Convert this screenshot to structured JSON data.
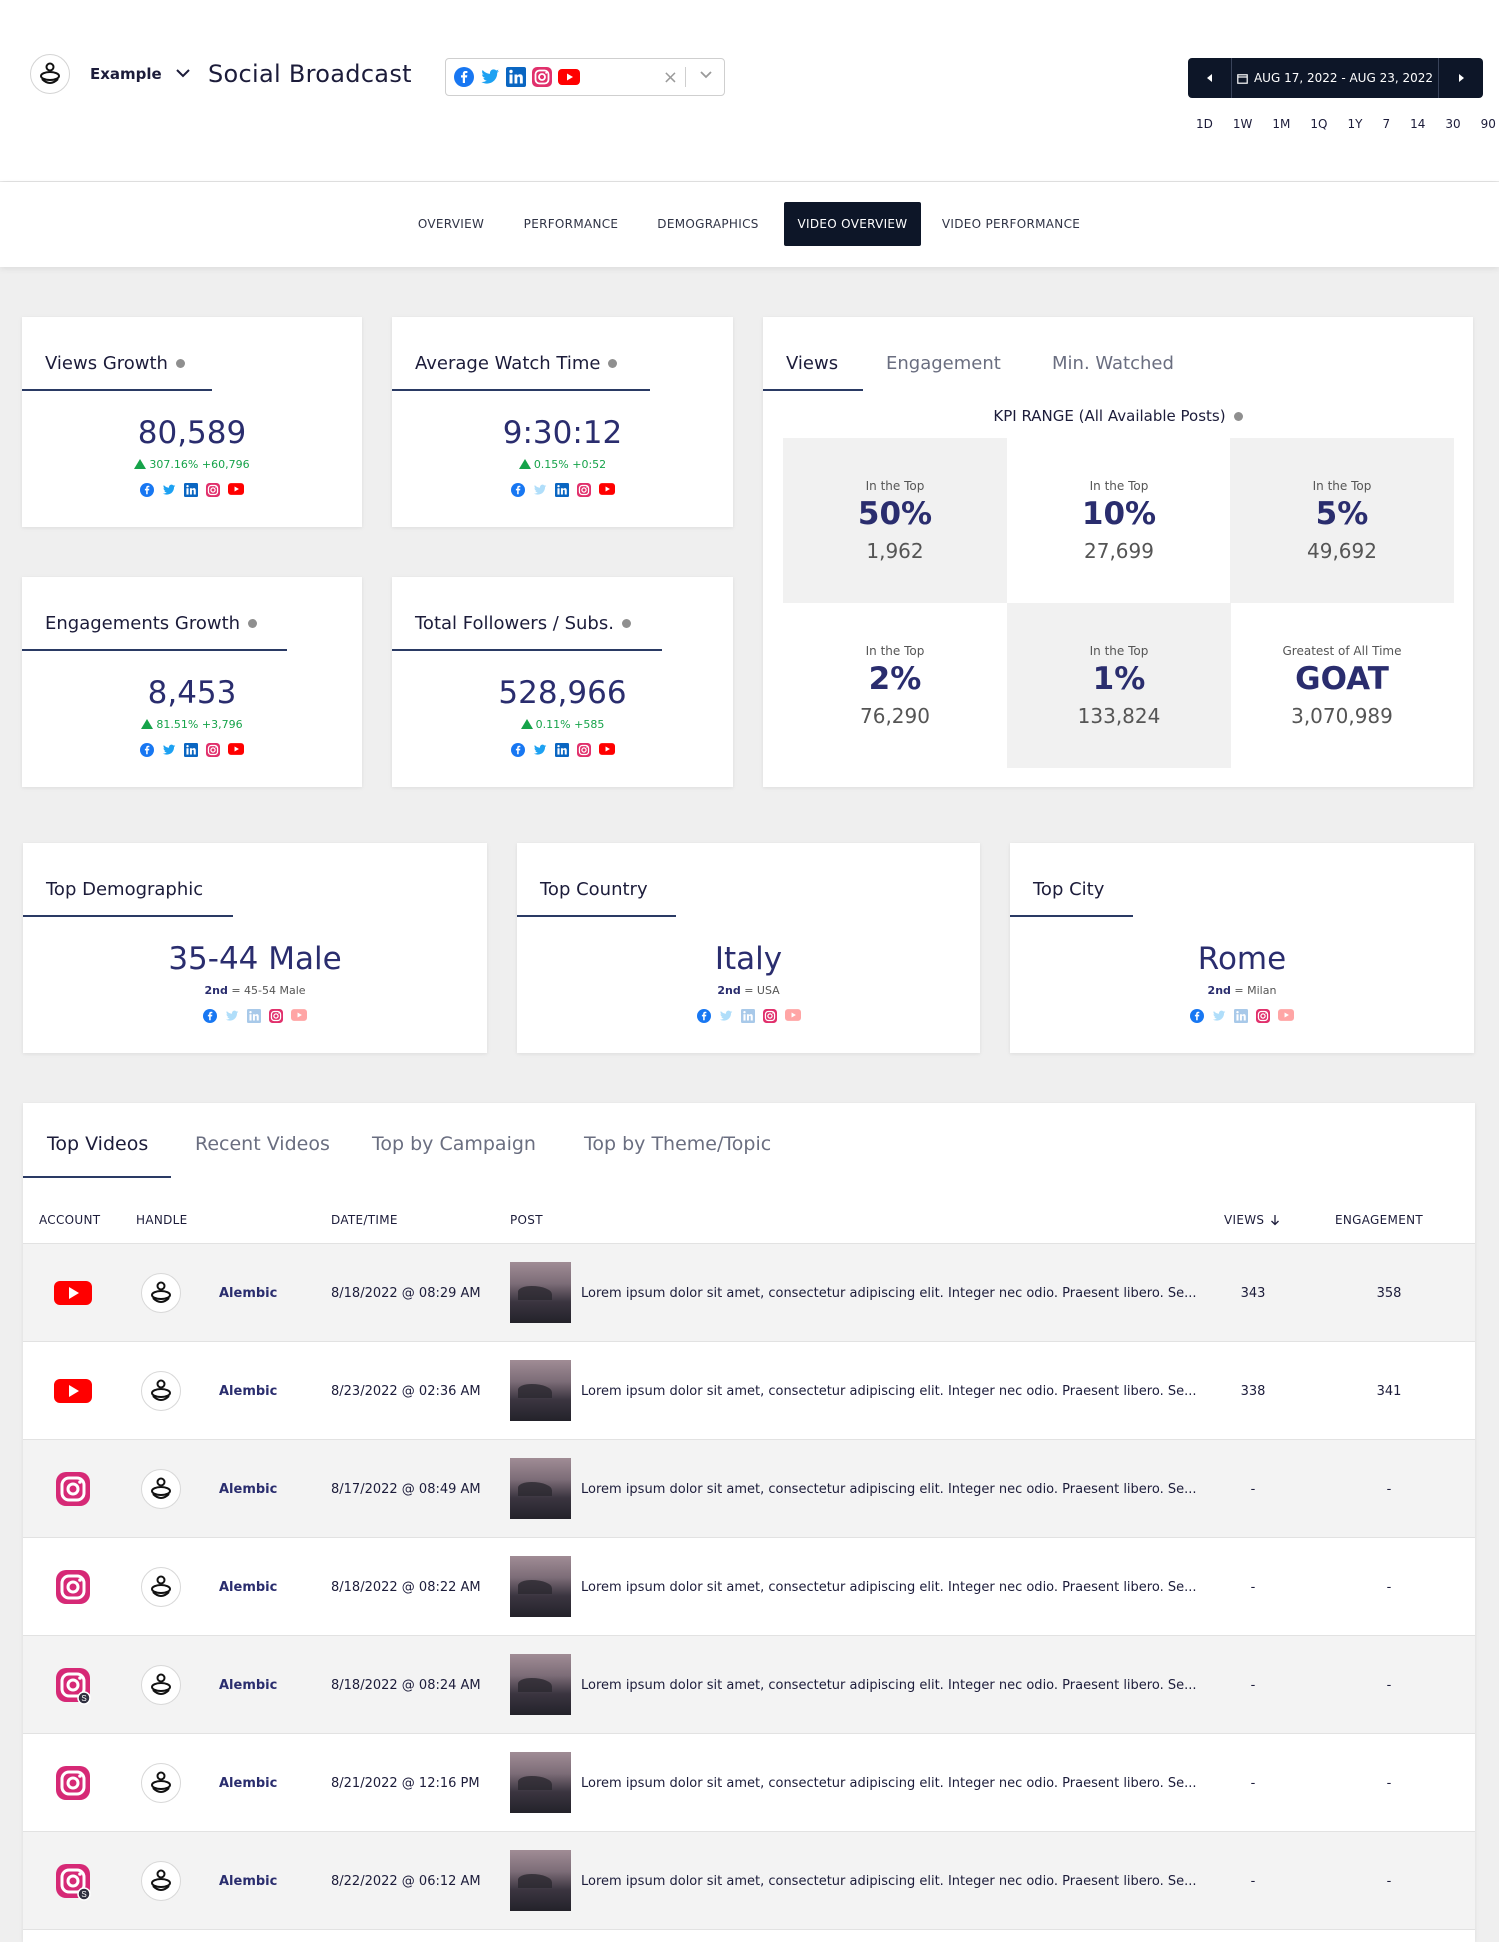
{
  "header": {
    "org_name": "Example",
    "app_title": "Social Broadcast",
    "platforms": [
      "facebook",
      "twitter",
      "linkedin",
      "instagram",
      "youtube"
    ],
    "clear_symbol": "×",
    "date_range": "AUG 17, 2022 - AUG 23, 2022",
    "quick_ranges": [
      "1D",
      "1W",
      "1M",
      "1Q",
      "1Y",
      "7",
      "14",
      "30",
      "90"
    ]
  },
  "tabs": [
    {
      "label": "OVERVIEW",
      "active": false
    },
    {
      "label": "PERFORMANCE",
      "active": false
    },
    {
      "label": "DEMOGRAPHICS",
      "active": false
    },
    {
      "label": "VIDEO OVERVIEW",
      "active": true
    },
    {
      "label": "VIDEO PERFORMANCE",
      "active": false
    }
  ],
  "metrics": {
    "views_growth": {
      "title": "Views Growth",
      "value": "80,589",
      "delta": "307.16% +60,796"
    },
    "avg_watch_time": {
      "title": "Average Watch Time",
      "value": "9:30:12",
      "delta": "0.15% +0:52"
    },
    "engagements_growth": {
      "title": "Engagements Growth",
      "value": "8,453",
      "delta": "81.51% +3,796"
    },
    "total_followers": {
      "title": "Total Followers / Subs.",
      "value": "528,966",
      "delta": "0.11% +585"
    }
  },
  "kpi": {
    "tabs": [
      "Views",
      "Engagement",
      "Min. Watched"
    ],
    "subtitle": "KPI RANGE (All Available Posts)",
    "cells": [
      {
        "label": "In the Top",
        "big": "50%",
        "value": "1,962"
      },
      {
        "label": "In the Top",
        "big": "10%",
        "value": "27,699"
      },
      {
        "label": "In the Top",
        "big": "5%",
        "value": "49,692"
      },
      {
        "label": "In the Top",
        "big": "2%",
        "value": "76,290"
      },
      {
        "label": "In the Top",
        "big": "1%",
        "value": "133,824"
      },
      {
        "label": "Greatest of All Time",
        "big": "GOAT",
        "value": "3,070,989"
      }
    ]
  },
  "demographics": {
    "top_demographic": {
      "title": "Top Demographic",
      "value": "35-44 Male",
      "second_label": "2nd",
      "second_value": "= 45-54 Male"
    },
    "top_country": {
      "title": "Top Country",
      "value": "Italy",
      "second_label": "2nd",
      "second_value": "= USA"
    },
    "top_city": {
      "title": "Top City",
      "value": "Rome",
      "second_label": "2nd",
      "second_value": "= Milan"
    }
  },
  "videos": {
    "tabs": [
      "Top Videos",
      "Recent Videos",
      "Top by Campaign",
      "Top by Theme/Topic"
    ],
    "columns": {
      "account": "ACCOUNT",
      "handle": "HANDLE",
      "datetime": "DATE/TIME",
      "post": "POST",
      "views": "VIEWS",
      "engagement": "ENGAGEMENT"
    },
    "rows": [
      {
        "account": "youtube",
        "handle": "Alembic",
        "datetime": "8/18/2022 @ 08:29 AM",
        "post": "Lorem ipsum dolor sit amet, consectetur adipiscing elit. Integer nec odio. Praesent libero. Se...",
        "views": "343",
        "engagement": "358"
      },
      {
        "account": "youtube",
        "handle": "Alembic",
        "datetime": "8/23/2022 @ 02:36 AM",
        "post": "Lorem ipsum dolor sit amet, consectetur adipiscing elit. Integer nec odio. Praesent libero. Se...",
        "views": "338",
        "engagement": "341"
      },
      {
        "account": "instagram",
        "handle": "Alembic",
        "datetime": "8/17/2022 @ 08:49 AM",
        "post": "Lorem ipsum dolor sit amet, consectetur adipiscing elit. Integer nec odio. Praesent libero. Se...",
        "views": "-",
        "engagement": "-"
      },
      {
        "account": "instagram",
        "handle": "Alembic",
        "datetime": "8/18/2022 @ 08:22 AM",
        "post": "Lorem ipsum dolor sit amet, consectetur adipiscing elit. Integer nec odio. Praesent libero. Se...",
        "views": "-",
        "engagement": "-"
      },
      {
        "account": "instagram-story",
        "handle": "Alembic",
        "datetime": "8/18/2022 @ 08:24 AM",
        "post": "Lorem ipsum dolor sit amet, consectetur adipiscing elit. Integer nec odio. Praesent libero. Se...",
        "views": "-",
        "engagement": "-"
      },
      {
        "account": "instagram",
        "handle": "Alembic",
        "datetime": "8/21/2022 @ 12:16 PM",
        "post": "Lorem ipsum dolor sit amet, consectetur adipiscing elit. Integer nec odio. Praesent libero. Se...",
        "views": "-",
        "engagement": "-"
      },
      {
        "account": "instagram-story",
        "handle": "Alembic",
        "datetime": "8/22/2022 @ 06:12 AM",
        "post": "Lorem ipsum dolor sit amet, consectetur adipiscing elit. Integer nec odio. Praesent libero. Se...",
        "views": "-",
        "engagement": "-"
      }
    ]
  },
  "colors": {
    "nav_dark": "#0d1628",
    "metric_text": "#2a2d6e",
    "positive": "#16a34a",
    "facebook": "#1877f2",
    "twitter": "#1da1f2",
    "linkedin": "#0a66c2",
    "instagram": "#e1306c",
    "youtube": "#ff0000"
  }
}
